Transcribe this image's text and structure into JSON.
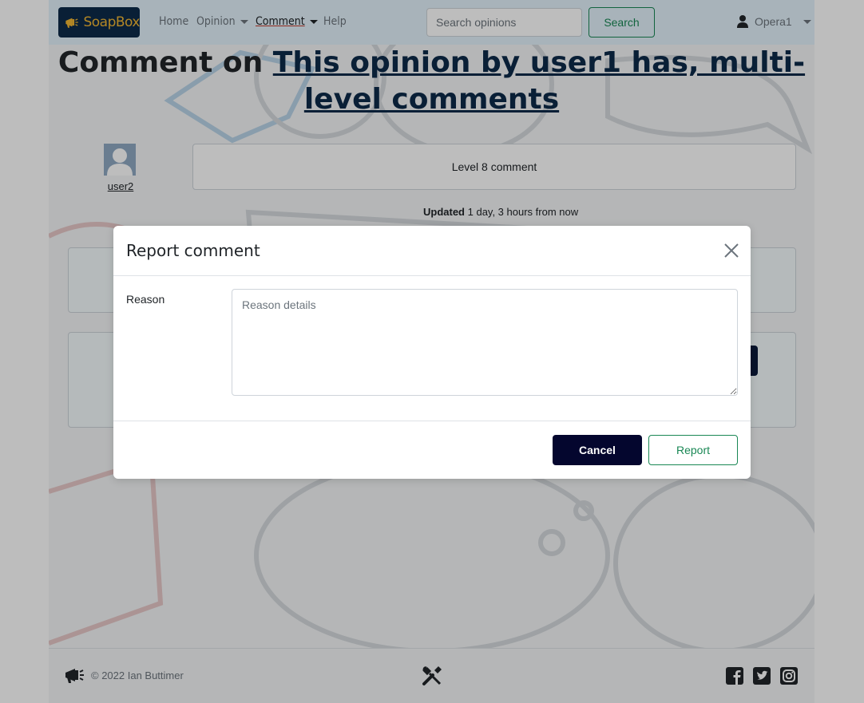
{
  "brand": {
    "name": "SoapBox"
  },
  "nav": {
    "home": "Home",
    "opinion": "Opinion",
    "comment": "Comment",
    "help": "Help",
    "search_placeholder": "Search opinions",
    "search_button": "Search",
    "user": "Opera1"
  },
  "heading": {
    "prefix": "Comment on ",
    "link": "This opinion by user1 has, multi-level comments"
  },
  "comment": {
    "author": "user2",
    "text": "Level 8 comment",
    "updated_label": "Updated",
    "updated_value": "1 day, 3 hours from now"
  },
  "modal": {
    "title": "Report comment",
    "reason_label": "Reason",
    "reason_placeholder": "Reason details",
    "cancel": "Cancel",
    "report": "Report"
  },
  "footer": {
    "copyright": "© 2022 Ian Buttimer"
  },
  "colors": {
    "brand_bg": "#0d2a4a",
    "brand_accent": "#f2b632",
    "success": "#198754",
    "cancel_bg": "#04062e"
  }
}
